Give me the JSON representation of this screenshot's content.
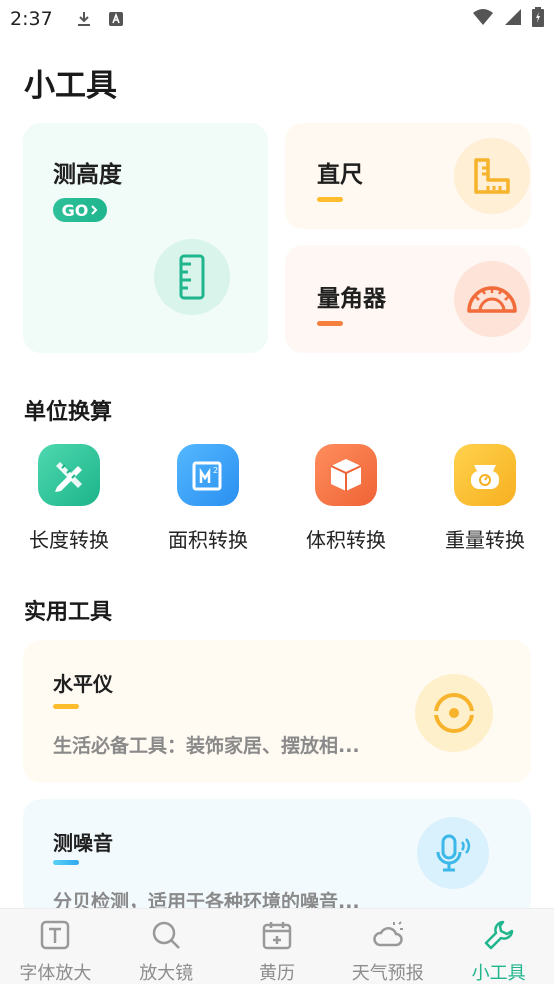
{
  "status_bar": {
    "time": "2:37"
  },
  "page": {
    "title": "小工具"
  },
  "top_cards": {
    "height": {
      "title": "测高度",
      "go": "GO"
    },
    "ruler": {
      "title": "直尺"
    },
    "protractor": {
      "title": "量角器"
    }
  },
  "unit_section": {
    "title": "单位换算",
    "items": [
      {
        "label": "长度转换",
        "icon": "pencil-ruler-icon"
      },
      {
        "label": "面积转换",
        "icon": "area-icon"
      },
      {
        "label": "体积转换",
        "icon": "cube-icon"
      },
      {
        "label": "重量转换",
        "icon": "scale-icon"
      }
    ]
  },
  "practical_section": {
    "title": "实用工具",
    "items": [
      {
        "title": "水平仪",
        "desc": "生活必备工具：装饰家居、摆放相..."
      },
      {
        "title": "测噪音",
        "desc": "分贝检测，适用于各种环境的噪音..."
      }
    ]
  },
  "tab_bar": {
    "tabs": [
      {
        "label": "字体放大",
        "active": false
      },
      {
        "label": "放大镜",
        "active": false
      },
      {
        "label": "黄历",
        "active": false
      },
      {
        "label": "天气预报",
        "active": false
      },
      {
        "label": "小工具",
        "active": true
      }
    ]
  },
  "colors": {
    "accent_green": "#1fb58d",
    "accent_yellow": "#ffd94a",
    "accent_orange": "#f5803e"
  }
}
